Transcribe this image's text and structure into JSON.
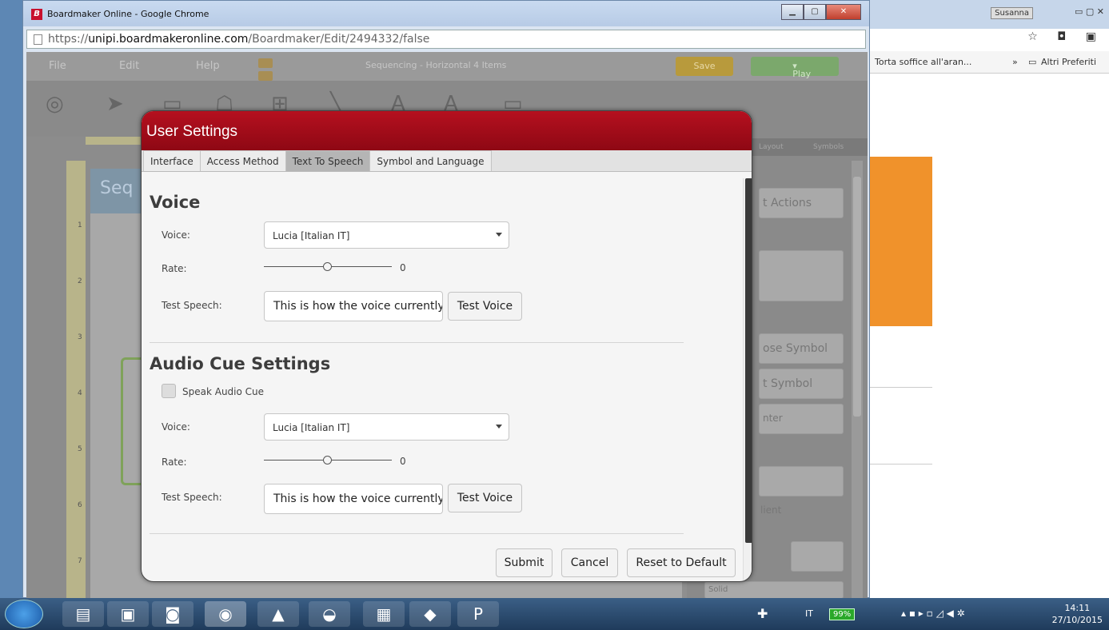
{
  "browser": {
    "window_title": "Boardmaker Online - Google Chrome",
    "url_scheme": "https://",
    "url_host": "unipi.boardmakeronline.com",
    "url_path": "/Boardmaker/Edit/2494332/false",
    "bookmark_1": "Torta soffice all'aran...",
    "bookmark_more": "»",
    "bookmark_folder": "Altri Preferiti",
    "user_badge": "Susanna"
  },
  "app": {
    "menu": [
      "File",
      "Edit",
      "Help"
    ],
    "document_title": "Sequencing - Horizontal 4 Items",
    "save_label": "Save",
    "play_label": "Play",
    "board_title": "Seq",
    "panel_tabs": [
      "Layout",
      "Symbols"
    ],
    "panel_buttons": [
      "t Actions",
      "ose Symbol",
      "t Symbol",
      "nter",
      "Solid",
      "lient"
    ],
    "ruler_numbers": [
      "1",
      "2",
      "3",
      "4",
      "5",
      "6",
      "7"
    ]
  },
  "dialog": {
    "title": "User Settings",
    "tabs": [
      "Interface",
      "Access Method",
      "Text To Speech",
      "Symbol and Language"
    ],
    "active_tab": "Text To Speech",
    "voice_section": {
      "heading": "Voice",
      "voice_label": "Voice:",
      "voice_value": "Lucia [Italian IT]",
      "rate_label": "Rate:",
      "rate_value": "0",
      "test_label": "Test Speech:",
      "test_text": "This is how the voice currently sounds",
      "test_button": "Test Voice"
    },
    "audio_cue_section": {
      "heading": "Audio Cue Settings",
      "checkbox_label": "Speak Audio Cue",
      "checkbox_checked": false,
      "voice_label": "Voice:",
      "voice_value": "Lucia [Italian IT]",
      "rate_label": "Rate:",
      "rate_value": "0",
      "test_label": "Test Speech:",
      "test_text": "This is how the voice currently sounds",
      "test_button": "Test Voice"
    },
    "footer": {
      "submit": "Submit",
      "cancel": "Cancel",
      "reset": "Reset to Default"
    }
  },
  "taskbar": {
    "language": "IT",
    "battery": "99%",
    "time": "14:11",
    "date": "27/10/2015"
  }
}
